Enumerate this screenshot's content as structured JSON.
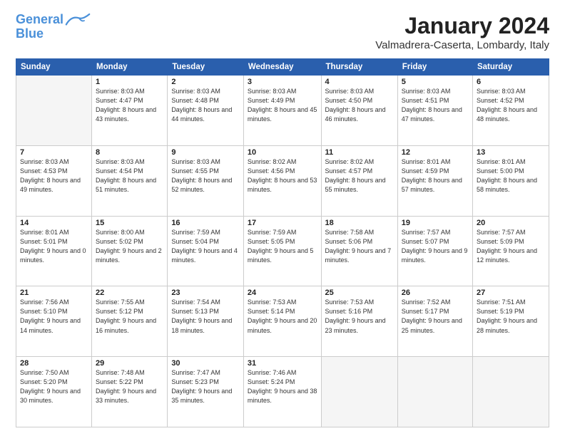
{
  "logo": {
    "line1": "General",
    "line2": "Blue"
  },
  "header": {
    "month": "January 2024",
    "location": "Valmadrera-Caserta, Lombardy, Italy"
  },
  "weekdays": [
    "Sunday",
    "Monday",
    "Tuesday",
    "Wednesday",
    "Thursday",
    "Friday",
    "Saturday"
  ],
  "weeks": [
    [
      {
        "day": "",
        "sunrise": "",
        "sunset": "",
        "daylight": ""
      },
      {
        "day": "1",
        "sunrise": "Sunrise: 8:03 AM",
        "sunset": "Sunset: 4:47 PM",
        "daylight": "Daylight: 8 hours and 43 minutes."
      },
      {
        "day": "2",
        "sunrise": "Sunrise: 8:03 AM",
        "sunset": "Sunset: 4:48 PM",
        "daylight": "Daylight: 8 hours and 44 minutes."
      },
      {
        "day": "3",
        "sunrise": "Sunrise: 8:03 AM",
        "sunset": "Sunset: 4:49 PM",
        "daylight": "Daylight: 8 hours and 45 minutes."
      },
      {
        "day": "4",
        "sunrise": "Sunrise: 8:03 AM",
        "sunset": "Sunset: 4:50 PM",
        "daylight": "Daylight: 8 hours and 46 minutes."
      },
      {
        "day": "5",
        "sunrise": "Sunrise: 8:03 AM",
        "sunset": "Sunset: 4:51 PM",
        "daylight": "Daylight: 8 hours and 47 minutes."
      },
      {
        "day": "6",
        "sunrise": "Sunrise: 8:03 AM",
        "sunset": "Sunset: 4:52 PM",
        "daylight": "Daylight: 8 hours and 48 minutes."
      }
    ],
    [
      {
        "day": "7",
        "sunrise": "Sunrise: 8:03 AM",
        "sunset": "Sunset: 4:53 PM",
        "daylight": "Daylight: 8 hours and 49 minutes."
      },
      {
        "day": "8",
        "sunrise": "Sunrise: 8:03 AM",
        "sunset": "Sunset: 4:54 PM",
        "daylight": "Daylight: 8 hours and 51 minutes."
      },
      {
        "day": "9",
        "sunrise": "Sunrise: 8:03 AM",
        "sunset": "Sunset: 4:55 PM",
        "daylight": "Daylight: 8 hours and 52 minutes."
      },
      {
        "day": "10",
        "sunrise": "Sunrise: 8:02 AM",
        "sunset": "Sunset: 4:56 PM",
        "daylight": "Daylight: 8 hours and 53 minutes."
      },
      {
        "day": "11",
        "sunrise": "Sunrise: 8:02 AM",
        "sunset": "Sunset: 4:57 PM",
        "daylight": "Daylight: 8 hours and 55 minutes."
      },
      {
        "day": "12",
        "sunrise": "Sunrise: 8:01 AM",
        "sunset": "Sunset: 4:59 PM",
        "daylight": "Daylight: 8 hours and 57 minutes."
      },
      {
        "day": "13",
        "sunrise": "Sunrise: 8:01 AM",
        "sunset": "Sunset: 5:00 PM",
        "daylight": "Daylight: 8 hours and 58 minutes."
      }
    ],
    [
      {
        "day": "14",
        "sunrise": "Sunrise: 8:01 AM",
        "sunset": "Sunset: 5:01 PM",
        "daylight": "Daylight: 9 hours and 0 minutes."
      },
      {
        "day": "15",
        "sunrise": "Sunrise: 8:00 AM",
        "sunset": "Sunset: 5:02 PM",
        "daylight": "Daylight: 9 hours and 2 minutes."
      },
      {
        "day": "16",
        "sunrise": "Sunrise: 7:59 AM",
        "sunset": "Sunset: 5:04 PM",
        "daylight": "Daylight: 9 hours and 4 minutes."
      },
      {
        "day": "17",
        "sunrise": "Sunrise: 7:59 AM",
        "sunset": "Sunset: 5:05 PM",
        "daylight": "Daylight: 9 hours and 5 minutes."
      },
      {
        "day": "18",
        "sunrise": "Sunrise: 7:58 AM",
        "sunset": "Sunset: 5:06 PM",
        "daylight": "Daylight: 9 hours and 7 minutes."
      },
      {
        "day": "19",
        "sunrise": "Sunrise: 7:57 AM",
        "sunset": "Sunset: 5:07 PM",
        "daylight": "Daylight: 9 hours and 9 minutes."
      },
      {
        "day": "20",
        "sunrise": "Sunrise: 7:57 AM",
        "sunset": "Sunset: 5:09 PM",
        "daylight": "Daylight: 9 hours and 12 minutes."
      }
    ],
    [
      {
        "day": "21",
        "sunrise": "Sunrise: 7:56 AM",
        "sunset": "Sunset: 5:10 PM",
        "daylight": "Daylight: 9 hours and 14 minutes."
      },
      {
        "day": "22",
        "sunrise": "Sunrise: 7:55 AM",
        "sunset": "Sunset: 5:12 PM",
        "daylight": "Daylight: 9 hours and 16 minutes."
      },
      {
        "day": "23",
        "sunrise": "Sunrise: 7:54 AM",
        "sunset": "Sunset: 5:13 PM",
        "daylight": "Daylight: 9 hours and 18 minutes."
      },
      {
        "day": "24",
        "sunrise": "Sunrise: 7:53 AM",
        "sunset": "Sunset: 5:14 PM",
        "daylight": "Daylight: 9 hours and 20 minutes."
      },
      {
        "day": "25",
        "sunrise": "Sunrise: 7:53 AM",
        "sunset": "Sunset: 5:16 PM",
        "daylight": "Daylight: 9 hours and 23 minutes."
      },
      {
        "day": "26",
        "sunrise": "Sunrise: 7:52 AM",
        "sunset": "Sunset: 5:17 PM",
        "daylight": "Daylight: 9 hours and 25 minutes."
      },
      {
        "day": "27",
        "sunrise": "Sunrise: 7:51 AM",
        "sunset": "Sunset: 5:19 PM",
        "daylight": "Daylight: 9 hours and 28 minutes."
      }
    ],
    [
      {
        "day": "28",
        "sunrise": "Sunrise: 7:50 AM",
        "sunset": "Sunset: 5:20 PM",
        "daylight": "Daylight: 9 hours and 30 minutes."
      },
      {
        "day": "29",
        "sunrise": "Sunrise: 7:48 AM",
        "sunset": "Sunset: 5:22 PM",
        "daylight": "Daylight: 9 hours and 33 minutes."
      },
      {
        "day": "30",
        "sunrise": "Sunrise: 7:47 AM",
        "sunset": "Sunset: 5:23 PM",
        "daylight": "Daylight: 9 hours and 35 minutes."
      },
      {
        "day": "31",
        "sunrise": "Sunrise: 7:46 AM",
        "sunset": "Sunset: 5:24 PM",
        "daylight": "Daylight: 9 hours and 38 minutes."
      },
      {
        "day": "",
        "sunrise": "",
        "sunset": "",
        "daylight": ""
      },
      {
        "day": "",
        "sunrise": "",
        "sunset": "",
        "daylight": ""
      },
      {
        "day": "",
        "sunrise": "",
        "sunset": "",
        "daylight": ""
      }
    ]
  ]
}
